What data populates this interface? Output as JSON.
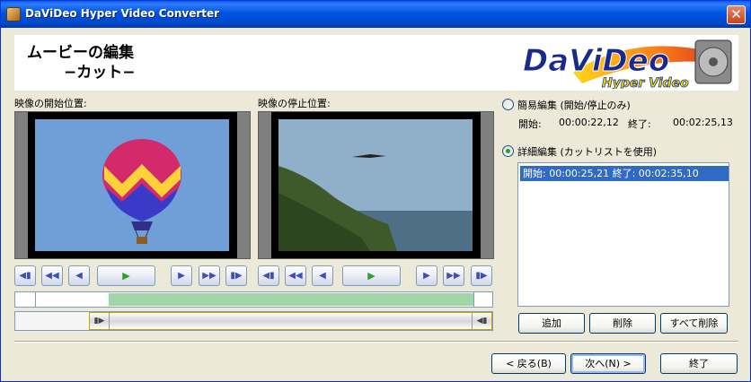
{
  "window": {
    "title": "DaViDeo Hyper Video Converter"
  },
  "header": {
    "title_line1": "ムービーの編集",
    "title_line2": "−カット−",
    "logo_text": "DaViDeo",
    "logo_sub": "Hyper Video"
  },
  "start_video": {
    "label": "映像の開始位置:"
  },
  "stop_video": {
    "label": "映像の停止位置:"
  },
  "simple_edit": {
    "label": "簡易編集 (開始/停止のみ)",
    "start_label": "開始:",
    "start_value": "00:00:22,12",
    "end_label": "終了:",
    "end_value": "00:02:25,13",
    "selected": false
  },
  "detail_edit": {
    "label": "詳細編集 (カットリストを使用)",
    "selected": true
  },
  "cut_list": [
    "開始: 00:00:25,21   終了: 00:02:35,10"
  ],
  "list_buttons": {
    "add": "追加",
    "delete": "削除",
    "delete_all": "すべて削除"
  },
  "footer": {
    "back": "< 戻る(B)",
    "next": "次へ(N) >",
    "finish": "終了"
  },
  "colors": {
    "titlebar": "#0054e3",
    "selection": "#316ac5",
    "timeline_fill": "#9fd6a6",
    "accent_radio": "#21a121"
  }
}
